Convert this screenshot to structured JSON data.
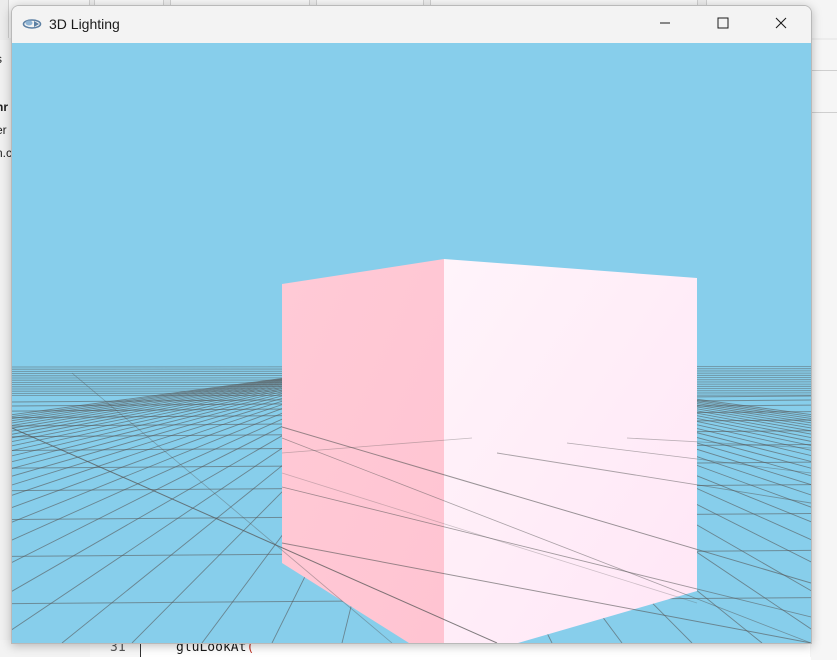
{
  "window": {
    "title": "3D Lighting",
    "app_icon": "opengl-app-icon",
    "controls": {
      "minimize_icon": "minimize-icon",
      "maximize_icon": "maximize-icon",
      "close_icon": "close-icon"
    }
  },
  "scene": {
    "sky_color": "#87ceeb",
    "grid_line_color": "#555555",
    "cube_shaded_face_color": "#ffcad6",
    "cube_lit_face_color": "#ffeefa"
  },
  "background_editor": {
    "left_panel_fragments": [
      "s",
      "hr",
      "er",
      "n.c"
    ],
    "code_line_number": "31",
    "code_line_text": "gluLookAt",
    "code_line_paren": "("
  }
}
